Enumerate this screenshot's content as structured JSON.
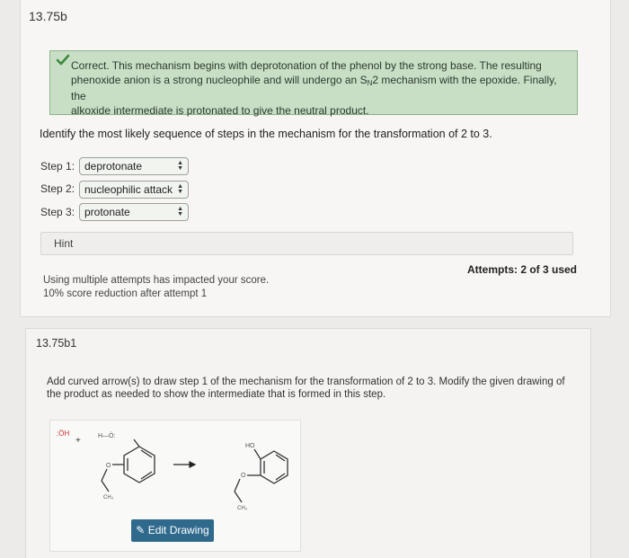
{
  "question": {
    "id": "13.75b",
    "feedback": {
      "line1": "Correct. This mechanism begins with deprotonation of the phenol by the strong base. The resulting",
      "line2a": "phenoxide anion is a strong nucleophile and will undergo an S",
      "line2sub": "N",
      "line2b": "2 mechanism with the epoxide. Finally, the",
      "line3": "alkoxide intermediate is protonated to give the neutral product."
    },
    "prompt": "Identify the most likely sequence of steps in the mechanism for the transformation of 2 to 3.",
    "steps": [
      {
        "label": "Step 1:",
        "value": "deprotonate"
      },
      {
        "label": "Step 2:",
        "value": "nucleophilic attack"
      },
      {
        "label": "Step 3:",
        "value": "protonate"
      }
    ],
    "hint_label": "Hint",
    "attempts_text": "Attempts: 2 of 3 used",
    "score_note1": "Using multiple attempts has impacted your score.",
    "score_note2": "10% score reduction after attempt 1"
  },
  "subquestion": {
    "id": "13.75b1",
    "instruction_line1": "Add curved arrow(s) to draw step 1 of the mechanism for the transformation of 2 to 3. Modify the given drawing of",
    "instruction_line2": "the product as needed to show the intermediate that is formed in this step.",
    "drawing": {
      "reagent1": ":ÖH",
      "plus": "+",
      "reagent2": "H—Ö:",
      "ho_label": "HO",
      "o_label1": "O",
      "o_label2": "O",
      "ch3_label1": "CH₃",
      "ch3_label2": "CH₃"
    },
    "edit_button": "Edit Drawing"
  },
  "colors": {
    "feedback_bg": "#c8dfc6",
    "check_green": "#3c8a3a",
    "button_blue": "#2f6a8d"
  }
}
